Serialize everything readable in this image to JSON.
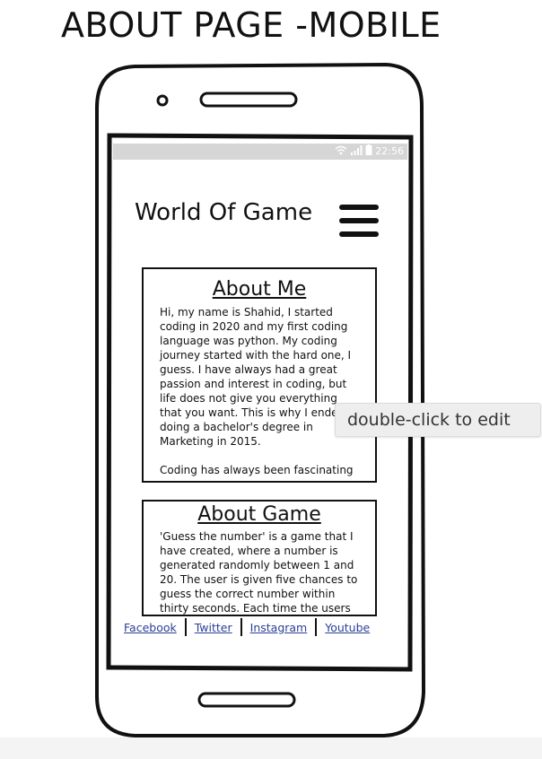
{
  "mockup": {
    "title": "ABOUT PAGE -MOBILE"
  },
  "status_bar": {
    "time": "22:56",
    "icons": [
      "wifi-icon",
      "signal-icon",
      "battery-icon"
    ]
  },
  "header": {
    "app_title": "World Of Game",
    "menu_icon": "hamburger-menu-icon"
  },
  "about_me": {
    "heading": "About Me",
    "body": "Hi, my name is Shahid, I started\ncoding in 2020 and my first coding\nlanguage was python. My coding\njourney started with the hard one, I\nguess. I have always had a great\npassion and interest in coding, but\nlife does not give you everything\nthat you want. This is why I ended\ndoing a bachelor's degree in\nMarketing in 2015.\n\nCoding has always been fascinating"
  },
  "about_game": {
    "heading": "About Game",
    "body": "'Guess the number' is a game that I\nhave created, where a number is\ngenerated randomly between 1 and\n20. The user is given five chances to\nguess the correct number within\nthirty seconds. Each time the users"
  },
  "footer": {
    "links": [
      "Facebook",
      "Twitter",
      "Instagram",
      "Youtube"
    ]
  },
  "tooltip": {
    "text": "double-click to edit"
  },
  "colors": {
    "link": "#2b3f97",
    "status_bar": "#d6d6d6",
    "tooltip_bg": "#eeeeee"
  }
}
